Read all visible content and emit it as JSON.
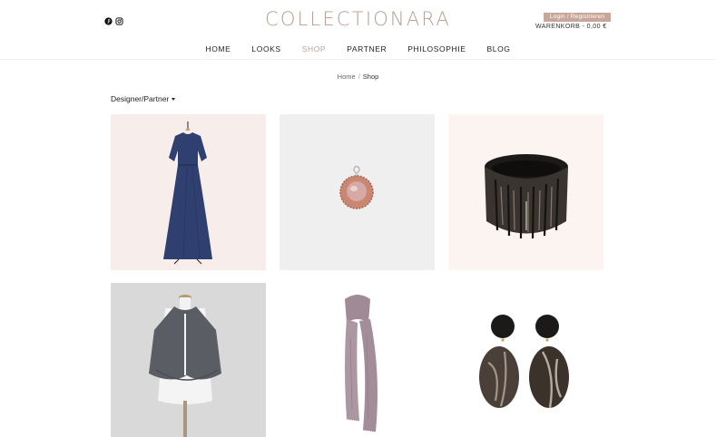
{
  "brand": {
    "logo_text": "COLLECTIONARA",
    "logo_color": "#b79d92"
  },
  "social": [
    {
      "icon": "pinterest-icon"
    },
    {
      "icon": "instagram-icon"
    }
  ],
  "account": {
    "login_label": "Login / Registrieren",
    "cart_label": "WARENKORB - 0,00 €"
  },
  "nav": {
    "items": [
      {
        "label": "HOME"
      },
      {
        "label": "LOOKS"
      },
      {
        "label": "SHOP"
      },
      {
        "label": "PARTNER"
      },
      {
        "label": "PHILOSOPHIE"
      },
      {
        "label": "BLOG"
      }
    ],
    "active": "SHOP",
    "active_color": "#b9a49b"
  },
  "breadcrumb": {
    "home": "Home",
    "separator": "/",
    "current": "Shop"
  },
  "filter": {
    "label": "Designer/Partner",
    "icon": "caret-down-icon"
  },
  "products": [
    {
      "name": "product-dress",
      "background": "#f7eeec",
      "depicts": "navy-long-dress"
    },
    {
      "name": "product-pendant",
      "background": "#efefef",
      "depicts": "rose-quartz-pendant"
    },
    {
      "name": "product-bracelet",
      "background": "#fbf4f1",
      "depicts": "horn-bracelet"
    },
    {
      "name": "product-cape",
      "background": "#d9d9d9",
      "depicts": "grey-cape"
    },
    {
      "name": "product-scarf",
      "background": "#ffffff",
      "depicts": "mauve-scarf"
    },
    {
      "name": "product-earrings",
      "background": "#ffffff",
      "depicts": "horn-earrings"
    }
  ]
}
